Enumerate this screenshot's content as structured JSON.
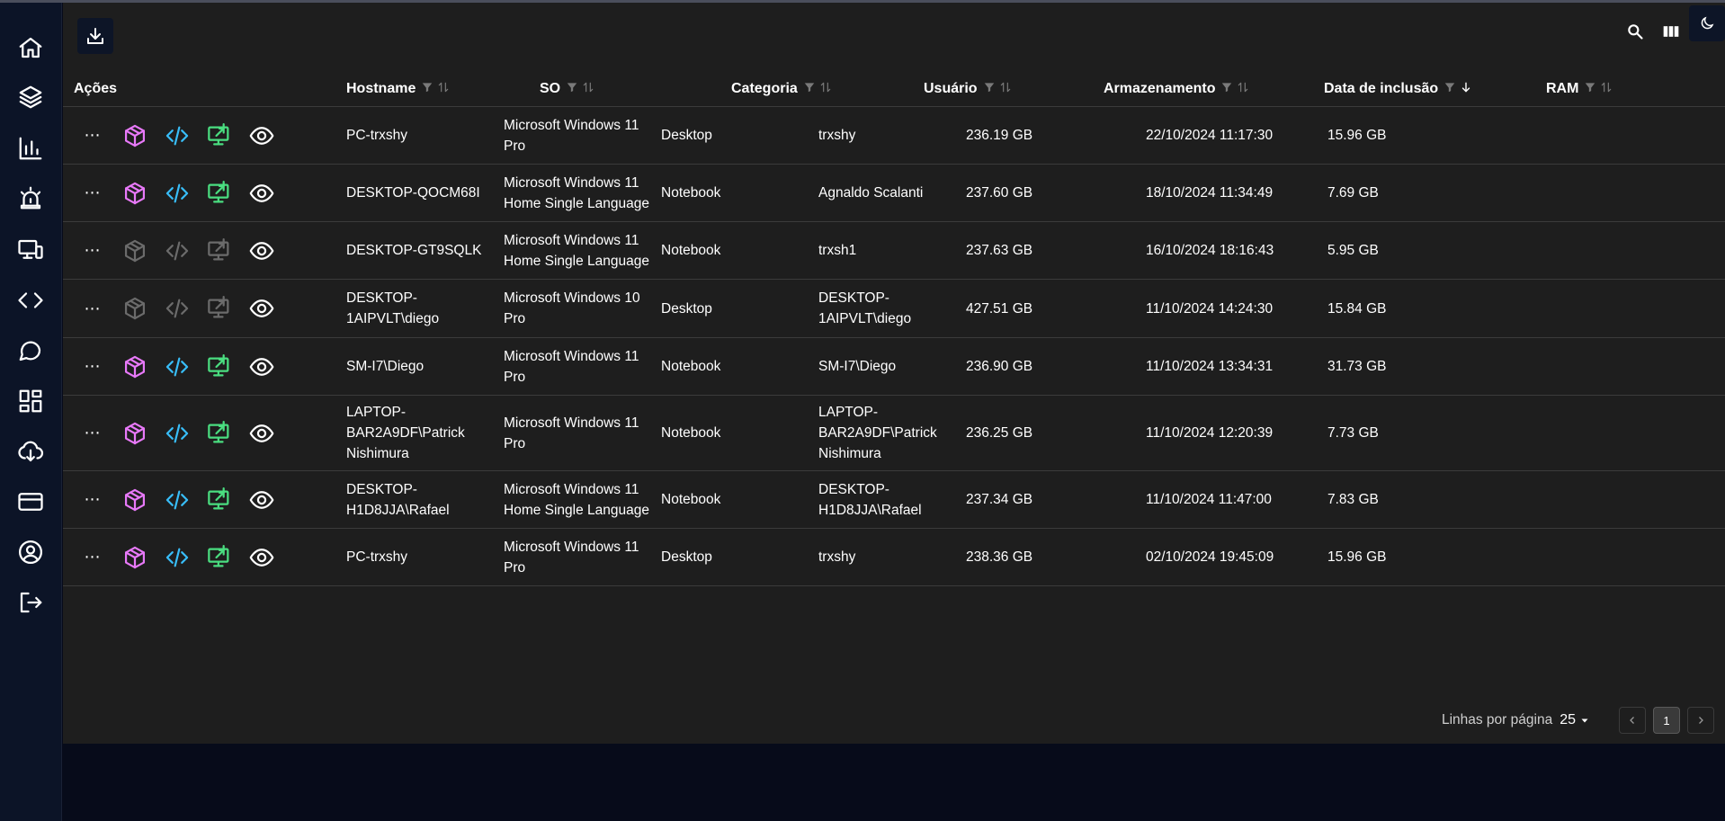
{
  "toolbar": {
    "download_icon": "download-icon"
  },
  "top_right": {
    "search_icon": "search-icon",
    "columns_icon": "columns-icon",
    "theme_icon": "moon-icon"
  },
  "sidebar": {
    "items": [
      {
        "icon": "home-icon"
      },
      {
        "icon": "layers-icon"
      },
      {
        "icon": "bar-chart-icon"
      },
      {
        "icon": "alarm-icon"
      },
      {
        "icon": "devices-icon"
      },
      {
        "icon": "code-icon"
      },
      {
        "icon": "chat-icon"
      },
      {
        "icon": "dashboard-icon"
      },
      {
        "icon": "cloud-download-icon"
      },
      {
        "icon": "credit-card-icon"
      },
      {
        "icon": "account-icon"
      },
      {
        "icon": "logout-icon"
      }
    ]
  },
  "table": {
    "headers": {
      "actions": "Ações",
      "hostname": "Hostname",
      "so": "SO",
      "categoria": "Categoria",
      "usuario": "Usuário",
      "armazenamento": "Armazenamento",
      "data": "Data de inclusão",
      "ram": "RAM"
    },
    "colors": {
      "package": "#e879f9",
      "code": "#38bdf8",
      "remote": "#4ade80",
      "disabled": "#6b6b6b"
    },
    "rows": [
      {
        "hostname": [
          "PC-trxshy"
        ],
        "so": [
          "Microsoft Windows 11",
          "Pro"
        ],
        "categoria": "Desktop",
        "usuario": [
          "trxshy"
        ],
        "armazenamento": "236.19 GB",
        "data": "22/10/2024 11:17:30",
        "ram": "15.96 GB",
        "enabled": true
      },
      {
        "hostname": [
          "DESKTOP-QOCM68I"
        ],
        "so": [
          "Microsoft Windows 11",
          "Home Single Language"
        ],
        "categoria": "Notebook",
        "usuario": [
          "Agnaldo Scalanti"
        ],
        "armazenamento": "237.60 GB",
        "data": "18/10/2024 11:34:49",
        "ram": "7.69 GB",
        "enabled": true
      },
      {
        "hostname": [
          "DESKTOP-GT9SQLK"
        ],
        "so": [
          "Microsoft Windows 11",
          "Home Single Language"
        ],
        "categoria": "Notebook",
        "usuario": [
          "trxsh1"
        ],
        "armazenamento": "237.63 GB",
        "data": "16/10/2024 18:16:43",
        "ram": "5.95 GB",
        "enabled": false
      },
      {
        "hostname": [
          "DESKTOP-",
          "1AIPVLT\\diego"
        ],
        "so": [
          "Microsoft Windows 10",
          "Pro"
        ],
        "categoria": "Desktop",
        "usuario": [
          "DESKTOP-",
          "1AIPVLT\\diego"
        ],
        "armazenamento": "427.51 GB",
        "data": "11/10/2024 14:24:30",
        "ram": "15.84 GB",
        "enabled": false
      },
      {
        "hostname": [
          "SM-I7\\Diego"
        ],
        "so": [
          "Microsoft Windows 11",
          "Pro"
        ],
        "categoria": "Notebook",
        "usuario": [
          "SM-I7\\Diego"
        ],
        "armazenamento": "236.90 GB",
        "data": "11/10/2024 13:34:31",
        "ram": "31.73 GB",
        "enabled": true
      },
      {
        "hostname": [
          "LAPTOP-",
          "BAR2A9DF\\Patrick",
          "Nishimura"
        ],
        "so": [
          "Microsoft Windows 11",
          "Pro"
        ],
        "categoria": "Notebook",
        "usuario": [
          "LAPTOP-",
          "BAR2A9DF\\Patrick",
          "Nishimura"
        ],
        "armazenamento": "236.25 GB",
        "data": "11/10/2024 12:20:39",
        "ram": "7.73 GB",
        "enabled": true
      },
      {
        "hostname": [
          "DESKTOP-",
          "H1D8JJA\\Rafael"
        ],
        "so": [
          "Microsoft Windows 11",
          "Home Single Language"
        ],
        "categoria": "Notebook",
        "usuario": [
          "DESKTOP-",
          "H1D8JJA\\Rafael"
        ],
        "armazenamento": "237.34 GB",
        "data": "11/10/2024 11:47:00",
        "ram": "7.83 GB",
        "enabled": true
      },
      {
        "hostname": [
          "PC-trxshy"
        ],
        "so": [
          "Microsoft Windows 11",
          "Pro"
        ],
        "categoria": "Desktop",
        "usuario": [
          "trxshy"
        ],
        "armazenamento": "238.36 GB",
        "data": "02/10/2024 19:45:09",
        "ram": "15.96 GB",
        "enabled": true
      }
    ]
  },
  "pagination": {
    "rows_label": "Linhas por página",
    "rows_value": "25",
    "current_page": "1"
  }
}
